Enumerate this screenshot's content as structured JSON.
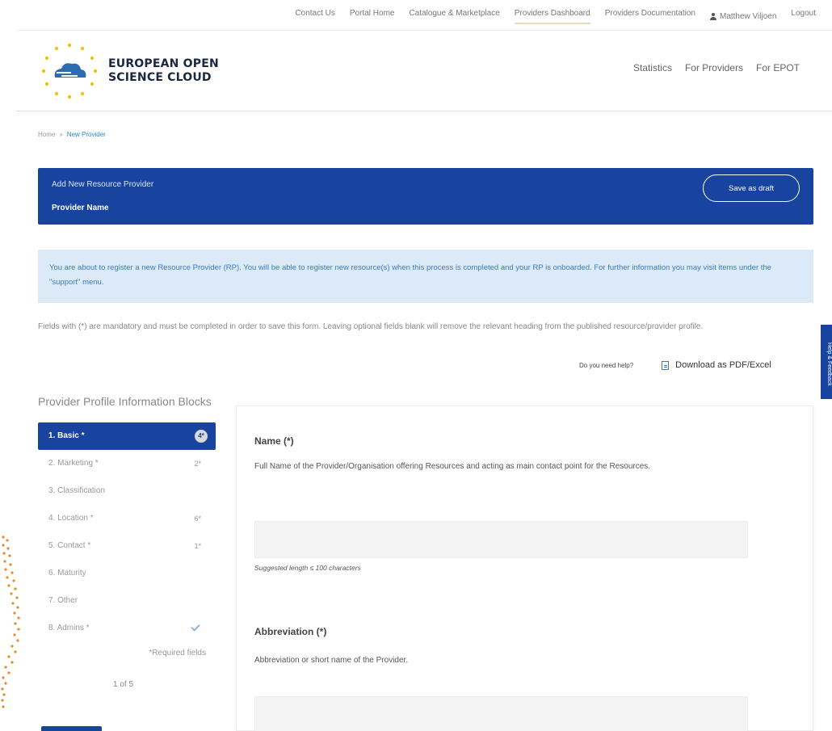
{
  "topbar": {
    "links": [
      "Contact Us",
      "Portal Home",
      "Catalogue & Marketplace",
      "Providers Dashboard",
      "Providers Documentation"
    ],
    "active_link": "Providers Dashboard",
    "user_name": "Matthew Viljoen",
    "logout": "Logout"
  },
  "header": {
    "logo_line1": "EUROPEAN OPEN",
    "logo_line2": "SCIENCE CLOUD",
    "nav": [
      "Statistics",
      "For Providers",
      "For EPOT"
    ]
  },
  "breadcrumb": {
    "home": "Home",
    "separator": "»",
    "current": "New Provider"
  },
  "banner": {
    "subtitle": "Add New Resource Provider",
    "title": "Provider Name",
    "save_draft": "Save as draft"
  },
  "info_text": "You are about to register a new Resource Provider (RP). You will be able to register new resource(s) when this process is completed and your RP is onboarded. For further information you may visit items under the \"support\" menu.",
  "mandatory_note": "Fields with (*) are mandatory and must be completed in order to save this form. Leaving optional fields blank will remove the relevant heading from the published resource/provider profile.",
  "help": {
    "need_help": "Do you need help?",
    "download": "Download as PDF/Excel"
  },
  "side_tab": "Help & Feedback",
  "sidebar": {
    "heading": "Provider Profile Information Blocks",
    "steps": [
      {
        "label": "1. Basic *",
        "badge": "4*"
      },
      {
        "label": "2. Marketing *",
        "badge": "2*"
      },
      {
        "label": "3. Classification",
        "badge": ""
      },
      {
        "label": "4. Location *",
        "badge": "6*"
      },
      {
        "label": "5. Contact *",
        "badge": "1*"
      },
      {
        "label": "6. Maturity",
        "badge": ""
      },
      {
        "label": "7. Other",
        "badge": ""
      },
      {
        "label": "8. Admins *",
        "badge": ""
      }
    ],
    "required_note": "*Required fields",
    "pager": "1 of 5"
  },
  "form": {
    "name_label": "Name (*)",
    "name_desc": "Full Name of the Provider/Organisation offering Resources and acting as main contact point for the Resources.",
    "name_value": "",
    "name_hint": "Suggested length ≤ 100 characters",
    "abbr_label": "Abbreviation (*)",
    "abbr_desc": "Abbreviation or short name of the Provider.",
    "abbr_value": ""
  },
  "colors": {
    "primary": "#1844a0",
    "info_bg": "#dce9f7",
    "info_text": "#3a7bbf",
    "accent_orange": "#e8892c",
    "logo_cloud": "#2b6bb0"
  }
}
